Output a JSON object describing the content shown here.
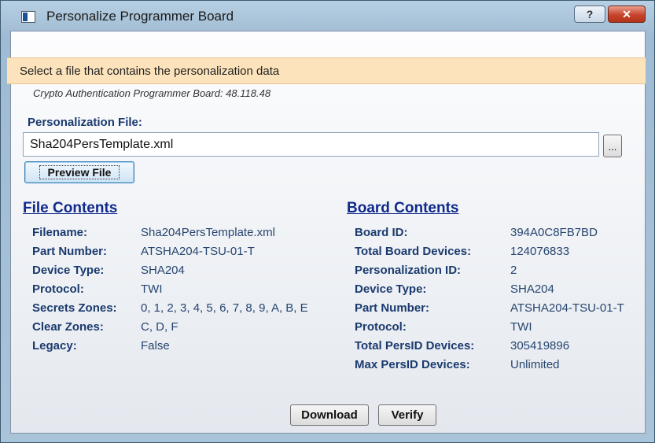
{
  "window": {
    "title": "Personalize Programmer Board",
    "help_label": "?",
    "close_label": "✕"
  },
  "banner": {
    "text": "Select a file that contains the personalization data"
  },
  "subtitle": "Crypto Authentication Programmer Board: 48.118.48",
  "personalization": {
    "label": "Personalization File:",
    "value": "Sha204PersTemplate.xml",
    "browse_label": "...",
    "preview_label": "Preview File"
  },
  "file_contents": {
    "title": "File Contents",
    "rows": [
      {
        "label": "Filename:",
        "value": "Sha204PersTemplate.xml"
      },
      {
        "label": "Part Number:",
        "value": "ATSHA204-TSU-01-T"
      },
      {
        "label": "Device Type:",
        "value": "SHA204"
      },
      {
        "label": "Protocol:",
        "value": "TWI"
      },
      {
        "label": "Secrets Zones:",
        "value": "0, 1, 2, 3, 4, 5, 6, 7, 8, 9, A, B, E"
      },
      {
        "label": "Clear Zones:",
        "value": "C, D, F"
      },
      {
        "label": "Legacy:",
        "value": "False"
      }
    ]
  },
  "board_contents": {
    "title": "Board Contents",
    "rows": [
      {
        "label": "Board ID:",
        "value": "394A0C8FB7BD"
      },
      {
        "label": "Total Board Devices:",
        "value": "124076833"
      },
      {
        "label": "Personalization ID:",
        "value": "2"
      },
      {
        "label": "Device Type:",
        "value": "SHA204"
      },
      {
        "label": "Part Number:",
        "value": "ATSHA204-TSU-01-T"
      },
      {
        "label": "Protocol:",
        "value": "TWI"
      },
      {
        "label": "Total PersID Devices:",
        "value": "305419896"
      },
      {
        "label": "Max PersID Devices:",
        "value": "Unlimited"
      }
    ]
  },
  "actions": {
    "download_label": "Download",
    "verify_label": "Verify"
  }
}
